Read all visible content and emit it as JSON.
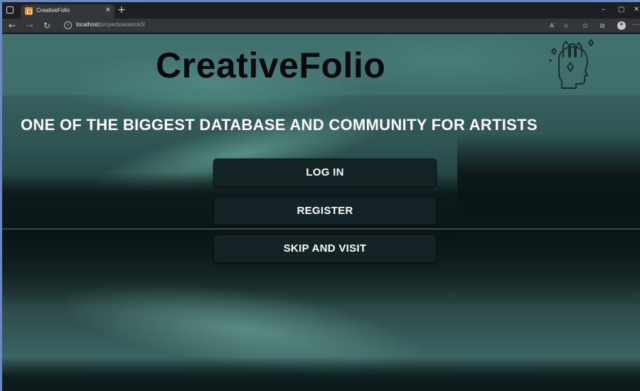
{
  "browser": {
    "tab_title": "CreativeFolio",
    "tab_close": "✕",
    "new_tab": "+",
    "url_host": "localhost",
    "url_path": "/proyectoavance3/",
    "read_aloud": "Aʾ",
    "window_controls": {
      "minimize": "–",
      "maximize": "▢",
      "close": "✕"
    },
    "nav": {
      "back": "←",
      "forward": "→",
      "reload": "↻",
      "more": "···"
    },
    "icons": [
      "window-menu-icon",
      "back-icon",
      "forward-icon",
      "reload-icon",
      "site-info-icon",
      "read-aloud-icon",
      "add-favorite-icon",
      "favorites-icon",
      "collections-icon",
      "profile-icon",
      "more-icon"
    ]
  },
  "page": {
    "brand": "CreativeFolio",
    "brand_icon": "creative-head-icon",
    "tagline": "ONE OF THE BIGGEST DATABASE AND COMMUNITY FOR ARTISTS",
    "buttons": {
      "login": "LOG IN",
      "register": "REGISTER",
      "skip": "SKIP AND VISIT"
    },
    "colors": {
      "button_bg": "#142325",
      "brand_text": "#0a0a0a",
      "tagline_text": "#ffffff"
    }
  }
}
